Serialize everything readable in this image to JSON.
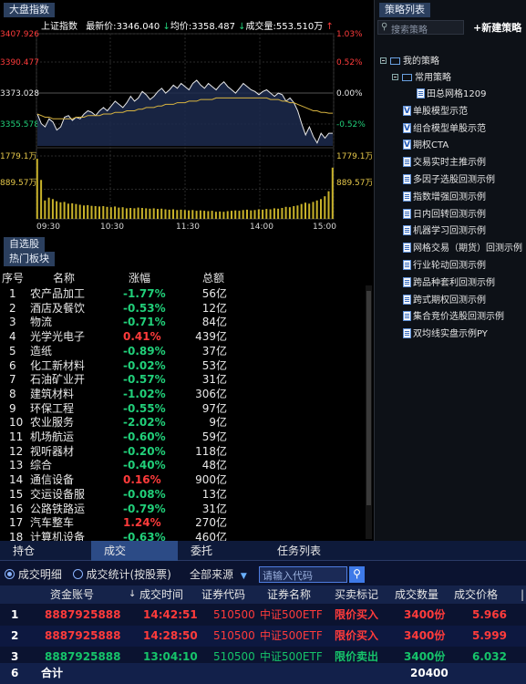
{
  "index_panel": {
    "tab": "大盘指数",
    "index_name": "上证指数",
    "latest_label": "最新价:",
    "latest_value": "3346.040",
    "avg_label": "均价:",
    "avg_value": "3358.487",
    "volume_label": "成交量:",
    "volume_value": "553.510万"
  },
  "chart_data": {
    "type": "line",
    "x_ticks": [
      "09:30",
      "10:30",
      "11:30",
      "14:00",
      "15:00"
    ],
    "price_axis_left": [
      "3407.926",
      "3390.477",
      "3373.028",
      "3355.578"
    ],
    "price_axis_right": [
      "1.03%",
      "0.52%",
      "0.00%",
      "-0.52%"
    ],
    "volume_axis_left": [
      "1779.1万",
      "889.57万"
    ],
    "volume_axis_right": [
      "1779.1万",
      "889.57万"
    ],
    "ylim": [
      3338.13,
      3407.926
    ],
    "prev_close": 3373.028,
    "series": [
      {
        "color": "#e8e8e8",
        "values": [
          3358,
          3352,
          3350,
          3355,
          3353,
          3348,
          3350,
          3356,
          3357,
          3354,
          3356,
          3355,
          3358,
          3360,
          3359,
          3357,
          3360,
          3362,
          3360,
          3363,
          3366,
          3364,
          3362,
          3365,
          3369,
          3366,
          3368,
          3372,
          3370,
          3367,
          3369,
          3372,
          3374,
          3371,
          3373,
          3376,
          3374,
          3377,
          3375,
          3373,
          3377,
          3379,
          3376,
          3374,
          3377,
          3375,
          3373,
          3376,
          3378,
          3375,
          3373,
          3371,
          3374,
          3377,
          3375,
          3373,
          3372,
          3370,
          3372,
          3373,
          3371,
          3369,
          3371,
          3370,
          3366,
          3368,
          3365,
          3360,
          3352,
          3345,
          3350,
          3344,
          3340,
          3346,
          3343,
          3346,
          3346
        ]
      },
      {
        "color": "#d8b440",
        "values": [
          3358,
          3357,
          3356,
          3356,
          3355,
          3355,
          3355,
          3355,
          3355,
          3355,
          3356,
          3356,
          3356,
          3357,
          3357,
          3357,
          3357,
          3358,
          3358,
          3358,
          3359,
          3359,
          3359,
          3360,
          3360,
          3360,
          3361,
          3361,
          3362,
          3362,
          3362,
          3363,
          3363,
          3364,
          3364,
          3364,
          3365,
          3365,
          3365,
          3366,
          3366,
          3366,
          3367,
          3367,
          3367,
          3367,
          3368,
          3368,
          3368,
          3368,
          3368,
          3368,
          3368,
          3368,
          3368,
          3368,
          3368,
          3368,
          3368,
          3368,
          3367,
          3367,
          3367,
          3366,
          3366,
          3365,
          3365,
          3364,
          3363,
          3362,
          3361,
          3360,
          3360,
          3359,
          3359,
          3358.5,
          3358.5
        ]
      }
    ],
    "volume_max": 1779.1,
    "volume": [
      1700,
      1100,
      520,
      600,
      560,
      500,
      470,
      480,
      430,
      440,
      420,
      400,
      380,
      390,
      370,
      360,
      350,
      360,
      340,
      330,
      350,
      320,
      330,
      300,
      310,
      300,
      320,
      310,
      300,
      290,
      300,
      280,
      290,
      270,
      260,
      270,
      250,
      260,
      250,
      240,
      250,
      230,
      240,
      230,
      220,
      230,
      200,
      210,
      200,
      220,
      230,
      240,
      230,
      250,
      260,
      240,
      250,
      270,
      260,
      280,
      270,
      300,
      290,
      310,
      340,
      330,
      360,
      380,
      420,
      460,
      430,
      480,
      520,
      560,
      640,
      780,
      1450
    ]
  },
  "side_tabs": {
    "watchlist": "自选股",
    "hot": "热门板块"
  },
  "sector_table": {
    "headers": [
      "序号",
      "名称",
      "涨幅",
      "总额"
    ],
    "rows": [
      {
        "idx": "1",
        "name": "农产品加工",
        "chg": "-1.77%",
        "amt": "56亿",
        "dir": "down"
      },
      {
        "idx": "2",
        "name": "酒店及餐饮",
        "chg": "-0.53%",
        "amt": "12亿",
        "dir": "down"
      },
      {
        "idx": "3",
        "name": "物流",
        "chg": "-0.71%",
        "amt": "84亿",
        "dir": "down"
      },
      {
        "idx": "4",
        "name": "光学光电子",
        "chg": "0.41%",
        "amt": "439亿",
        "dir": "up"
      },
      {
        "idx": "5",
        "name": "造纸",
        "chg": "-0.89%",
        "amt": "37亿",
        "dir": "down"
      },
      {
        "idx": "6",
        "name": "化工新材料",
        "chg": "-0.02%",
        "amt": "53亿",
        "dir": "down"
      },
      {
        "idx": "7",
        "name": "石油矿业开",
        "chg": "-0.57%",
        "amt": "31亿",
        "dir": "down"
      },
      {
        "idx": "8",
        "name": "建筑材料",
        "chg": "-1.02%",
        "amt": "306亿",
        "dir": "down"
      },
      {
        "idx": "9",
        "name": "环保工程",
        "chg": "-0.55%",
        "amt": "97亿",
        "dir": "down"
      },
      {
        "idx": "10",
        "name": "农业服务",
        "chg": "-2.02%",
        "amt": "9亿",
        "dir": "down"
      },
      {
        "idx": "11",
        "name": "机场航运",
        "chg": "-0.60%",
        "amt": "59亿",
        "dir": "down"
      },
      {
        "idx": "12",
        "name": "视听器材",
        "chg": "-0.20%",
        "amt": "118亿",
        "dir": "down"
      },
      {
        "idx": "13",
        "name": "综合",
        "chg": "-0.40%",
        "amt": "48亿",
        "dir": "down"
      },
      {
        "idx": "14",
        "name": "通信设备",
        "chg": "0.16%",
        "amt": "900亿",
        "dir": "up"
      },
      {
        "idx": "15",
        "name": "交运设备服",
        "chg": "-0.08%",
        "amt": "13亿",
        "dir": "down"
      },
      {
        "idx": "16",
        "name": "公路铁路运",
        "chg": "-0.79%",
        "amt": "31亿",
        "dir": "down"
      },
      {
        "idx": "17",
        "name": "汽车整车",
        "chg": "1.24%",
        "amt": "270亿",
        "dir": "up"
      },
      {
        "idx": "18",
        "name": "计算机设备",
        "chg": "-0.63%",
        "amt": "460亿",
        "dir": "down"
      }
    ]
  },
  "strategy_panel": {
    "tab": "策略列表",
    "search_placeholder": "搜索策略",
    "new_button": "+新建策略",
    "my_strategies": "我的策略",
    "common": "常用策略",
    "items": [
      {
        "label": "田总网格1209",
        "icon": "doc",
        "indent": 2
      },
      {
        "label": "单股模型示范",
        "icon": "v",
        "indent": 1
      },
      {
        "label": "组合模型单股示范",
        "icon": "v",
        "indent": 1
      },
      {
        "label": "期权CTA",
        "icon": "v",
        "indent": 1
      },
      {
        "label": "交易实时主推示例",
        "icon": "doc",
        "indent": 1
      },
      {
        "label": "多因子选股回测示例",
        "icon": "doc",
        "indent": 1
      },
      {
        "label": "指数增强回测示例",
        "icon": "doc",
        "indent": 1
      },
      {
        "label": "日内回转回测示例",
        "icon": "doc",
        "indent": 1
      },
      {
        "label": "机器学习回测示例",
        "icon": "doc",
        "indent": 1
      },
      {
        "label": "网格交易（期货）回测示例",
        "icon": "doc",
        "indent": 1
      },
      {
        "label": "行业轮动回测示例",
        "icon": "doc",
        "indent": 1
      },
      {
        "label": "跨品种套利回测示例",
        "icon": "doc",
        "indent": 1
      },
      {
        "label": "跨式期权回测示例",
        "icon": "doc",
        "indent": 1
      },
      {
        "label": "集合竞价选股回测示例",
        "icon": "doc",
        "indent": 1
      },
      {
        "label": "双均线实盘示例PY",
        "icon": "doc",
        "indent": 1
      }
    ]
  },
  "trade_panel": {
    "tabs": [
      "持仓",
      "成交",
      "委托",
      "任务列表"
    ],
    "active_tab": 1,
    "radio_detail": "成交明细",
    "radio_stat": "成交统计(按股票)",
    "source_select": "全部来源",
    "code_placeholder": "请输入代码",
    "headers": [
      "资金账号",
      "成交时间",
      "证券代码",
      "证券名称",
      "买卖标记",
      "成交数量",
      "成交价格"
    ],
    "rows": [
      {
        "no": "1",
        "account": "8887925888",
        "time": "14:42:51",
        "code": "510500",
        "name": "中证500ETF",
        "side": "限价买入",
        "qty": "3400份",
        "price": "5.966",
        "dir": "buy"
      },
      {
        "no": "2",
        "account": "8887925888",
        "time": "14:28:50",
        "code": "510500",
        "name": "中证500ETF",
        "side": "限价买入",
        "qty": "3400份",
        "price": "5.999",
        "dir": "buy"
      },
      {
        "no": "3",
        "account": "8887925888",
        "time": "13:04:10",
        "code": "510500",
        "name": "中证500ETF",
        "side": "限价卖出",
        "qty": "3400份",
        "price": "6.032",
        "dir": "sell"
      }
    ],
    "total_no": "6",
    "total_label": "合计",
    "total_qty": "20400"
  }
}
